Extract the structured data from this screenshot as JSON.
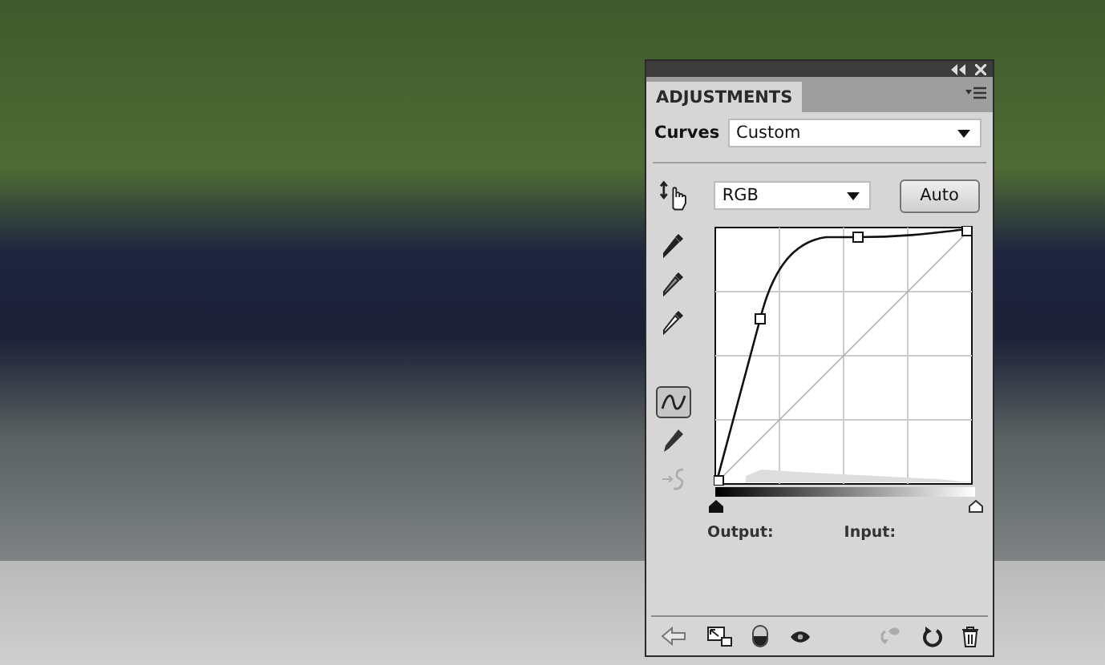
{
  "panel": {
    "tab": {
      "label": "ADJUSTMENTS",
      "selected": true
    },
    "adjustment": {
      "label": "Curves",
      "preset": "Custom"
    },
    "channel": "RGB",
    "auto_button": "Auto",
    "tools": [
      {
        "kind": "eyedropper-black",
        "selected": false,
        "disabled": false
      },
      {
        "kind": "eyedropper-gray",
        "selected": false,
        "disabled": false
      },
      {
        "kind": "eyedropper-white",
        "selected": false,
        "disabled": false
      },
      {
        "kind": "curve",
        "selected": true,
        "disabled": false
      },
      {
        "kind": "pencil",
        "selected": false,
        "disabled": false
      },
      {
        "kind": "smooth",
        "selected": false,
        "disabled": true
      }
    ],
    "input_sliders": [
      {
        "kind": "shadow",
        "level": 0
      },
      {
        "kind": "highlight",
        "level": 1
      }
    ],
    "output_label": "Output:",
    "input_label": "Input:",
    "footer": [
      {
        "kind": "back",
        "disabled": false
      },
      {
        "kind": "expand",
        "disabled": false
      },
      {
        "kind": "clip",
        "disabled": false
      },
      {
        "kind": "eye",
        "disabled": false
      },
      {
        "kind": "previous",
        "disabled": true
      },
      {
        "kind": "reset",
        "disabled": false
      },
      {
        "kind": "delete",
        "disabled": false
      }
    ]
  }
}
